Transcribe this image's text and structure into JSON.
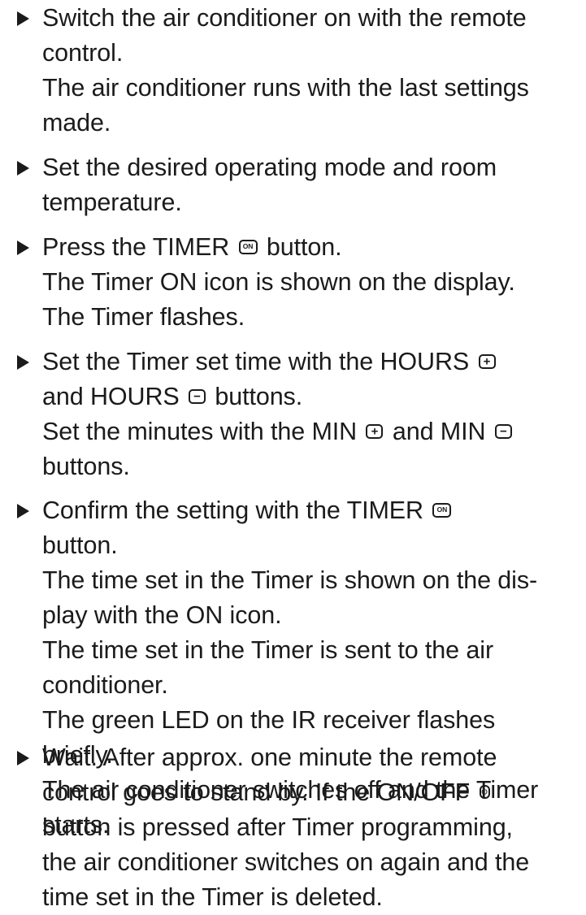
{
  "steps": [
    {
      "lines": [
        "Switch the air conditioner on with the remote",
        "control.",
        "The air conditioner runs with the last settings",
        "made."
      ]
    },
    {
      "lines": [
        "Set the desired operating mode and room",
        "temperature."
      ]
    },
    {
      "line1_prefix": "Press the TIMER",
      "line1_suffix": " button.",
      "lines": [
        "The Timer ON icon is shown on the display.",
        "The Timer flashes."
      ]
    },
    {
      "line1": "Set the Timer set time with the HOURS",
      "line2_prefix": "and HOURS",
      "line2_suffix": "buttons.",
      "line3_a": "Set the minutes with the MIN",
      "line3_b": " and MIN",
      "line4": "buttons."
    },
    {
      "line1": "Confirm the setting with the TIMER",
      "lines": [
        "button.",
        "The time set in the Timer is shown on the dis-",
        "play with the ON icon.",
        "The time set in the Timer is sent to the air",
        "conditioner.",
        "The green LED on the IR receiver flashes",
        "briefly.",
        "The air conditioner switches off and the Timer",
        "starts."
      ]
    },
    {
      "line1": "Wait. After approx. one minute the remote",
      "line2_prefix": "control goes to stand by. If the ON/OFF",
      "lines": [
        "button is pressed after Timer programming,",
        "the air conditioner switches on again and the",
        "time set in the Timer is deleted."
      ]
    }
  ],
  "icons": {
    "timer_on_label": "ON",
    "plus_symbol": "+",
    "minus_symbol": "−",
    "power_symbol": "⏻"
  }
}
